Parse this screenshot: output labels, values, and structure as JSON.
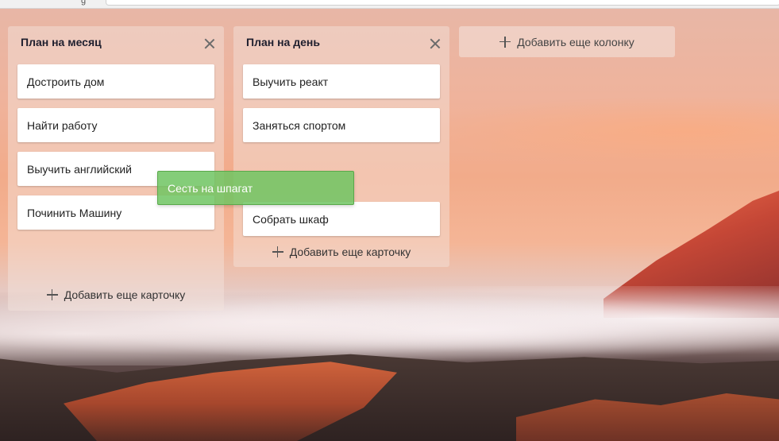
{
  "columns": [
    {
      "title": "План на месяц",
      "cards": [
        "Достроить дом",
        "Найти работу",
        "Выучить английский",
        "Починить Машину"
      ],
      "add_card_label": "Добавить еще карточку"
    },
    {
      "title": "План на день",
      "cards": [
        "Выучить реакт",
        "Заняться спортом",
        "Собрать шкаф"
      ],
      "add_card_label": "Добавить еще карточку"
    }
  ],
  "add_column_label": "Добавить еще колонку",
  "dragging_card": "Сесть на шпагат",
  "icons": {
    "close": "close-icon",
    "add": "plus-icon"
  },
  "colors": {
    "drag_card": "#6ec462",
    "card": "#ffffff",
    "title": "#1f1f2e"
  }
}
